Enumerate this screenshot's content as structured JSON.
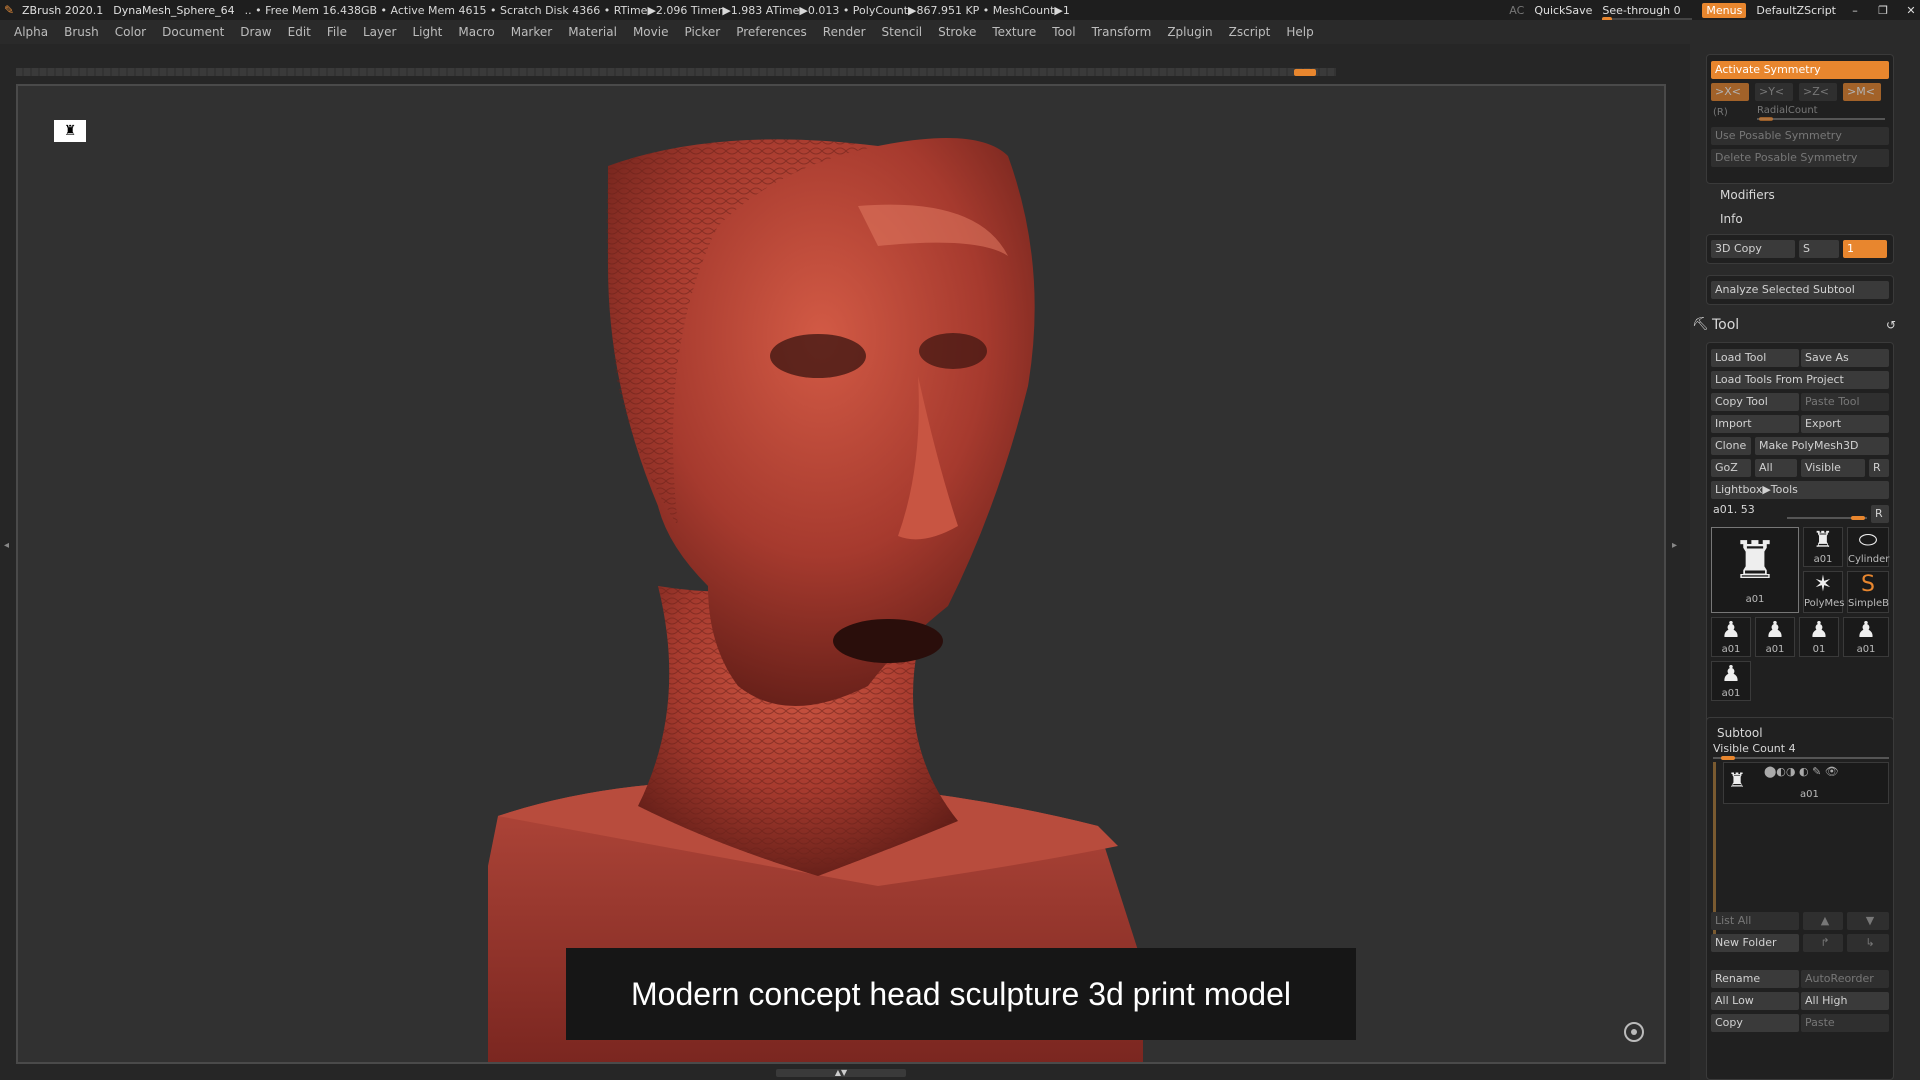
{
  "titlebar": {
    "app": "ZBrush 2020.1",
    "doc": "DynaMesh_Sphere_64",
    "stats": ".. • Free Mem 16.438GB • Active Mem 4615 • Scratch Disk 4366 •  RTime▶2.096 Timer▶1.983 ATime▶0.013 • PolyCount▶867.951 KP  • MeshCount▶1",
    "ac": "AC",
    "quicksave": "QuickSave",
    "seethrough": "See-through  0",
    "menus": "Menus",
    "zscript": "DefaultZScript"
  },
  "menu": [
    "Alpha",
    "Brush",
    "Color",
    "Document",
    "Draw",
    "Edit",
    "File",
    "Layer",
    "Light",
    "Macro",
    "Marker",
    "Material",
    "Movie",
    "Picker",
    "Preferences",
    "Render",
    "Stencil",
    "Stroke",
    "Texture",
    "Tool",
    "Transform",
    "Zplugin",
    "Zscript",
    "Help"
  ],
  "canvas": {
    "caption": "Modern concept head sculpture 3d print model"
  },
  "colors": {
    "accent": "#e8862e",
    "sculpt": "#a63a2e",
    "background": "#313131"
  },
  "right": {
    "symmetry": {
      "activate": "Activate Symmetry",
      "x": ">X<",
      "y": ">Y<",
      "z": ">Z<",
      "m": ">M<",
      "r": "(R)",
      "radial": "RadialCount",
      "posable": "Use Posable Symmetry",
      "delete_posable": "Delete Posable Symmetry"
    },
    "modifiers": "Modifiers",
    "info": "Info",
    "copy3d": "3D Copy",
    "copy_s": "S",
    "copy_val": "1",
    "analyze": "Analyze Selected Subtool",
    "tool": {
      "title": "Tool",
      "load": "Load Tool",
      "saveas": "Save As",
      "load_project": "Load Tools From Project",
      "copy": "Copy Tool",
      "paste": "Paste Tool",
      "import": "Import",
      "export": "Export",
      "clone": "Clone",
      "polymesh": "Make PolyMesh3D",
      "goz": "GoZ",
      "all": "All",
      "visible": "Visible",
      "r": "R",
      "lightbox": "Lightbox▶Tools",
      "current": "a01. 53",
      "thumbs": [
        {
          "label": "a01"
        },
        {
          "label": "a01"
        },
        {
          "label": "Cylinder"
        },
        {
          "label": "PolyMes"
        },
        {
          "label": "SimpleB"
        },
        {
          "label": "a01"
        },
        {
          "label": "a01"
        },
        {
          "label": "01"
        },
        {
          "label": "a01"
        },
        {
          "label": "a01"
        }
      ]
    },
    "subtool": {
      "title": "Subtool",
      "visible_count": "Visible Count 4",
      "item": "a01",
      "list_all": "List All",
      "new_folder": "New Folder",
      "rename": "Rename",
      "autoreorder": "AutoReorder",
      "all_low": "All Low",
      "all_high": "All High",
      "copy": "Copy",
      "paste": "Paste"
    }
  }
}
